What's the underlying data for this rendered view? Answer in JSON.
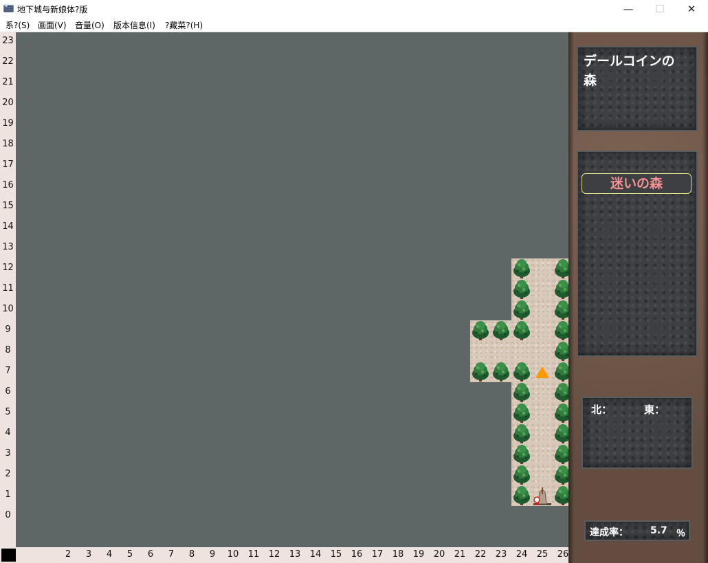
{
  "window": {
    "title": "地下城与新娘体?版",
    "minimize": "—",
    "maximize": "☐",
    "close": "✕"
  },
  "menu": [
    "系?(S)",
    "画面(V)",
    "音量(O)",
    "版本信息(I)",
    "?藏菜?(H)"
  ],
  "ruler": {
    "y_labels": [
      "23",
      "22",
      "21",
      "20",
      "19",
      "18",
      "17",
      "16",
      "15",
      "14",
      "13",
      "12",
      "11",
      "10",
      "9",
      "8",
      "7",
      "6",
      "5",
      "4",
      "3",
      "2",
      "1",
      "0"
    ],
    "x_labels": [
      "2",
      "3",
      "4",
      "5",
      "6",
      "7",
      "8",
      "9",
      "10",
      "11",
      "12",
      "13",
      "14",
      "15",
      "16",
      "17",
      "18",
      "19",
      "20",
      "21",
      "22",
      "23",
      "24",
      "25",
      "26"
    ]
  },
  "map": {
    "floor_cells": [
      [
        24,
        12
      ],
      [
        25,
        12
      ],
      [
        26,
        12
      ],
      [
        24,
        11
      ],
      [
        25,
        11
      ],
      [
        26,
        11
      ],
      [
        24,
        10
      ],
      [
        25,
        10
      ],
      [
        26,
        10
      ],
      [
        22,
        9
      ],
      [
        23,
        9
      ],
      [
        24,
        9
      ],
      [
        25,
        9
      ],
      [
        26,
        9
      ],
      [
        22,
        8
      ],
      [
        23,
        8
      ],
      [
        24,
        8
      ],
      [
        25,
        8
      ],
      [
        26,
        8
      ],
      [
        22,
        7
      ],
      [
        23,
        7
      ],
      [
        24,
        7
      ],
      [
        25,
        7
      ],
      [
        26,
        7
      ],
      [
        24,
        6
      ],
      [
        25,
        6
      ],
      [
        26,
        6
      ],
      [
        24,
        5
      ],
      [
        25,
        5
      ],
      [
        26,
        5
      ],
      [
        24,
        4
      ],
      [
        25,
        4
      ],
      [
        26,
        4
      ],
      [
        24,
        3
      ],
      [
        25,
        3
      ],
      [
        26,
        3
      ],
      [
        24,
        2
      ],
      [
        25,
        2
      ],
      [
        26,
        2
      ],
      [
        24,
        1
      ],
      [
        25,
        1
      ],
      [
        26,
        1
      ]
    ],
    "trees": [
      [
        24,
        12
      ],
      [
        26,
        12
      ],
      [
        24,
        11
      ],
      [
        26,
        11
      ],
      [
        24,
        10
      ],
      [
        26,
        10
      ],
      [
        22,
        9
      ],
      [
        23,
        9
      ],
      [
        24,
        9
      ],
      [
        26,
        9
      ],
      [
        26,
        8
      ],
      [
        22,
        7
      ],
      [
        23,
        7
      ],
      [
        24,
        7
      ],
      [
        26,
        7
      ],
      [
        24,
        6
      ],
      [
        26,
        6
      ],
      [
        24,
        5
      ],
      [
        26,
        5
      ],
      [
        24,
        4
      ],
      [
        26,
        4
      ],
      [
        24,
        3
      ],
      [
        26,
        3
      ],
      [
        24,
        2
      ],
      [
        26,
        2
      ],
      [
        24,
        1
      ],
      [
        26,
        1
      ]
    ],
    "player": [
      25,
      7
    ],
    "entrance": [
      25,
      1
    ],
    "colors": {
      "background": "#5f6766",
      "floor": "#d9c9bb",
      "player": "#ff9900"
    }
  },
  "sidebar": {
    "area_name": "デールコインの森",
    "floor_name": "迷いの森",
    "coords": {
      "north_label": "北：",
      "east_label": "東："
    },
    "completion": {
      "label": "達成率：",
      "value": "5.7",
      "unit": "％"
    }
  }
}
